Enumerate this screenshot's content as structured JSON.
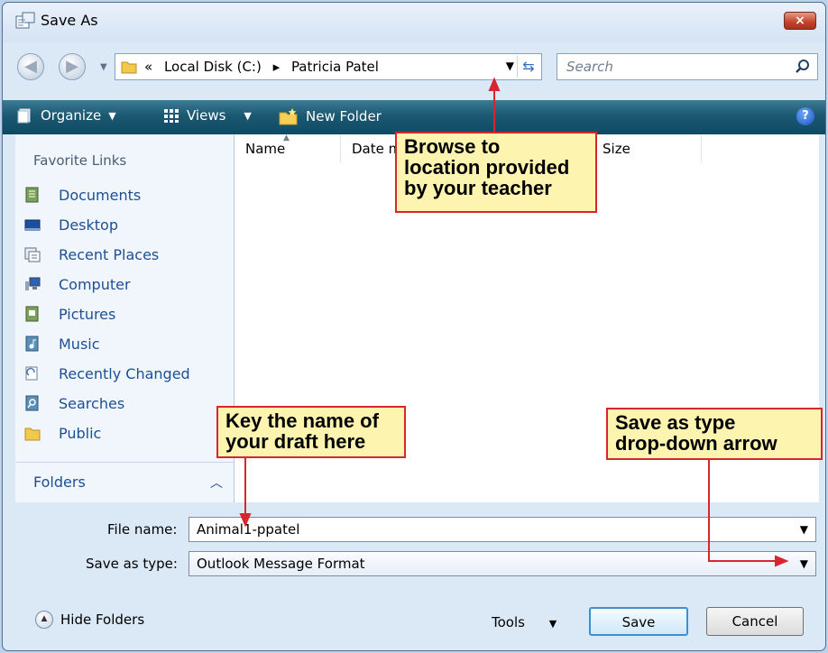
{
  "window": {
    "title": "Save As"
  },
  "titlebar": {
    "close_label": "×"
  },
  "nav": {
    "back_label": "◀",
    "forward_label": "▶",
    "breadcrumb": [
      "«",
      "Local Disk (C:)",
      "▸",
      "Patricia Patel"
    ],
    "search_placeholder": "Search"
  },
  "toolbar": {
    "organize": "Organize",
    "views": "Views",
    "new_folder": "New Folder",
    "help": "?"
  },
  "sidebar": {
    "heading": "Favorite Links",
    "items": [
      {
        "label": "Documents",
        "icon": "documents-icon"
      },
      {
        "label": "Desktop",
        "icon": "desktop-icon"
      },
      {
        "label": "Recent Places",
        "icon": "recent-places-icon"
      },
      {
        "label": "Computer",
        "icon": "computer-icon"
      },
      {
        "label": "Pictures",
        "icon": "pictures-icon"
      },
      {
        "label": "Music",
        "icon": "music-icon"
      },
      {
        "label": "Recently Changed",
        "icon": "recently-changed-icon"
      },
      {
        "label": "Searches",
        "icon": "searches-icon"
      },
      {
        "label": "Public",
        "icon": "public-icon"
      }
    ],
    "folders_label": "Folders"
  },
  "filelist": {
    "columns": [
      "Name",
      "Date m",
      "Size"
    ]
  },
  "form": {
    "filename_label": "File name:",
    "filename_value": "Animal1-ppatel",
    "savetype_label": "Save as type:",
    "savetype_value": "Outlook Message Format"
  },
  "footer": {
    "hide_folders": "Hide Folders",
    "tools": "Tools",
    "save": "Save",
    "cancel": "Cancel"
  },
  "callouts": {
    "browse": [
      "Browse to",
      "location provided",
      "by your teacher"
    ],
    "key_name": [
      "Key the name of",
      "your draft here"
    ],
    "save_type": [
      "Save as type",
      "drop-down arrow"
    ]
  },
  "colors": {
    "callout_fill": "#fdf4b0",
    "callout_border": "#d7262e",
    "toolbar": "#1b5872",
    "link": "#1b4f96"
  }
}
